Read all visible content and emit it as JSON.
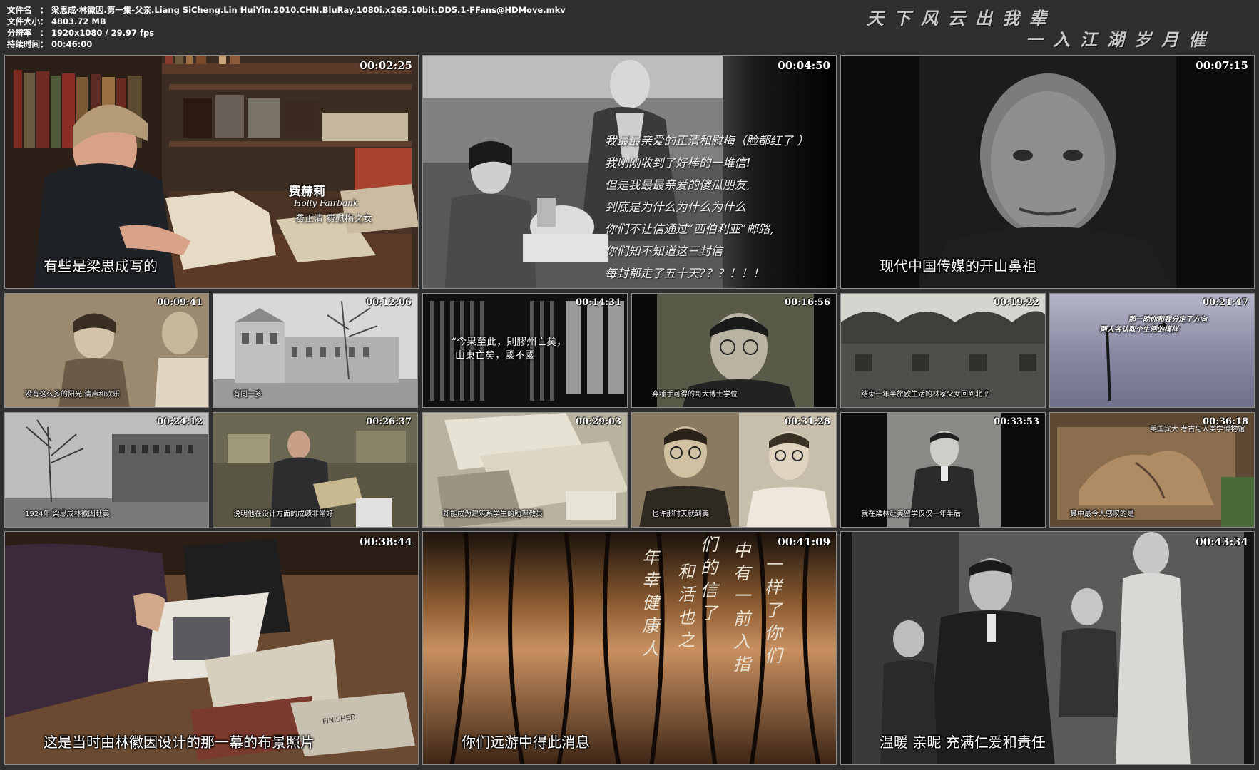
{
  "header": {
    "rows": [
      {
        "label": "文件名　：",
        "value": "梁思成·林徽因.第一集-父亲.Liang SiCheng.Lin HuiYin.2010.CHN.BluRay.1080i.x265.10bit.DD5.1-FFans@HDMove.mkv"
      },
      {
        "label": "文件大小：",
        "value": "4803.72 MB"
      },
      {
        "label": "分辨率　：",
        "value": "1920x1080 / 29.97 fps"
      },
      {
        "label": "持续时间：",
        "value": "00:46:00"
      }
    ],
    "slogan_line1": "天下风云出我辈",
    "slogan_line2": "一入江湖岁月催"
  },
  "tiles": [
    {
      "timestamp": "00:02:25",
      "subtitle": "有些是梁思成写的",
      "name_cn": "费赫莉",
      "name_en": "Holly Fairbank",
      "name_desc": "费正清 费慰梅之女"
    },
    {
      "timestamp": "00:04:50",
      "poem": [
        "我最最亲爱的正清和慰梅（脸都红了 ）",
        "我刚刚收到了好棒的一堆信!",
        "但是我最最亲爱的傻瓜朋友,",
        "到底是为什么为什么为什么",
        "你们不让信通过“西伯利亚”邮路,",
        "你们知不知道这三封信",
        "每封都走了五十天?？？！！！"
      ]
    },
    {
      "timestamp": "00:07:15",
      "subtitle": "现代中国传媒的开山鼻祖"
    },
    {
      "timestamp": "00:09:41",
      "subtitle": "没有这么多的阳光 清声和欢乐"
    },
    {
      "timestamp": "00:12:06",
      "subtitle": "有同一多"
    },
    {
      "timestamp": "00:14:31",
      "quote_line1": "“今果至此，則膠州亡矣，",
      "quote_line2": "山東亡矣，國不國"
    },
    {
      "timestamp": "00:16:56",
      "subtitle": "弃唾手可得的哥大博士学位"
    },
    {
      "timestamp": "00:19:22",
      "subtitle": "结束一年半旅欧生活的林家父女回到北平"
    },
    {
      "timestamp": "00:21:47",
      "caption_line1": "那一晚你和我分定了方向",
      "caption_line2": "两人各认取个生活的模样"
    },
    {
      "timestamp": "00:24:12",
      "subtitle": "1924年 梁思成林徽因赴美"
    },
    {
      "timestamp": "00:26:37",
      "subtitle": "说明他在设计方面的成绩非常好"
    },
    {
      "timestamp": "00:29:03",
      "subtitle": "却能成为建筑系学生的助理教员"
    },
    {
      "timestamp": "00:31:28",
      "subtitle": "也许那时天就到美"
    },
    {
      "timestamp": "00:33:53",
      "subtitle": "就在梁林赴美留学仅仅一年半后"
    },
    {
      "timestamp": "00:36:18",
      "subtitle": "其中最令人感叹的是",
      "caption_top": "美国宾大 考古与人类学博物馆"
    },
    {
      "timestamp": "00:38:44",
      "subtitle": "这是当时由林徽因设计的那一幕的布景照片",
      "book_text": "FINISHED"
    },
    {
      "timestamp": "00:41:09",
      "subtitle": "你们远游中得此消息",
      "calligraphy": [
        "们的信了",
        "中有一前入指",
        "和活也之",
        "年幸健康人",
        "一样了你们"
      ]
    },
    {
      "timestamp": "00:43:34",
      "subtitle": "温暖 亲昵 充满仁爱和责任"
    }
  ],
  "colors": {
    "background": "#2f2f2f",
    "border": "#8c8c8c",
    "text": "#ffffff"
  }
}
